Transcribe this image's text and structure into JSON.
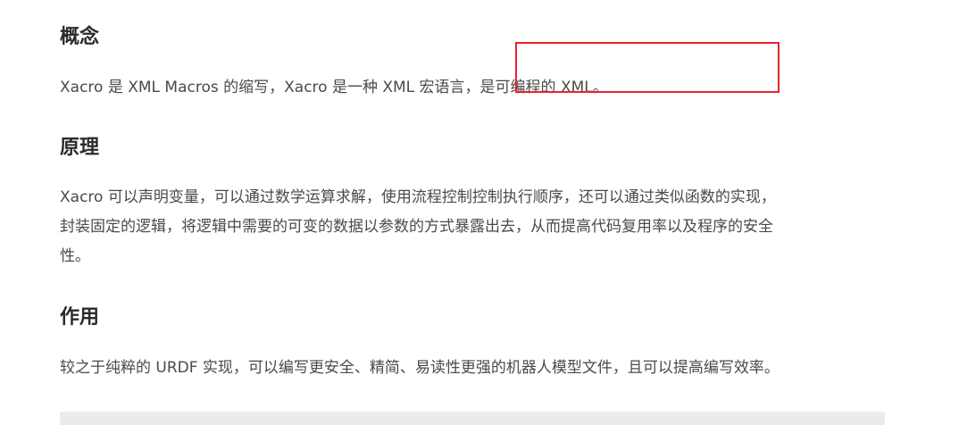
{
  "sections": {
    "concept": {
      "title": "概念",
      "lines": [
        "Xacro 是 XML Macros 的缩写，Xacro 是一种 XML 宏语言，是可编程的 XML。"
      ]
    },
    "principle": {
      "title": "原理",
      "lines": [
        "Xacro 可以声明变量，可以通过数学运算求解，使用流程控制控制执行顺序，还可以通过类似函数的实现，",
        "封装固定的逻辑，将逻辑中需要的可变的数据以参数的方式暴露出去，从而提高代码复用率以及程序的安全",
        "性。"
      ]
    },
    "usage": {
      "title": "作用",
      "lines": [
        "较之于纯粹的 URDF 实现，可以编写更安全、精简、易读性更强的机器人模型文件，且可以提高编写效率。"
      ]
    }
  },
  "colors": {
    "annotation_border": "#e8242c",
    "heading_text": "#2b2b2b",
    "body_text": "#4a4a4a",
    "code_block_bg": "#ebebeb"
  }
}
